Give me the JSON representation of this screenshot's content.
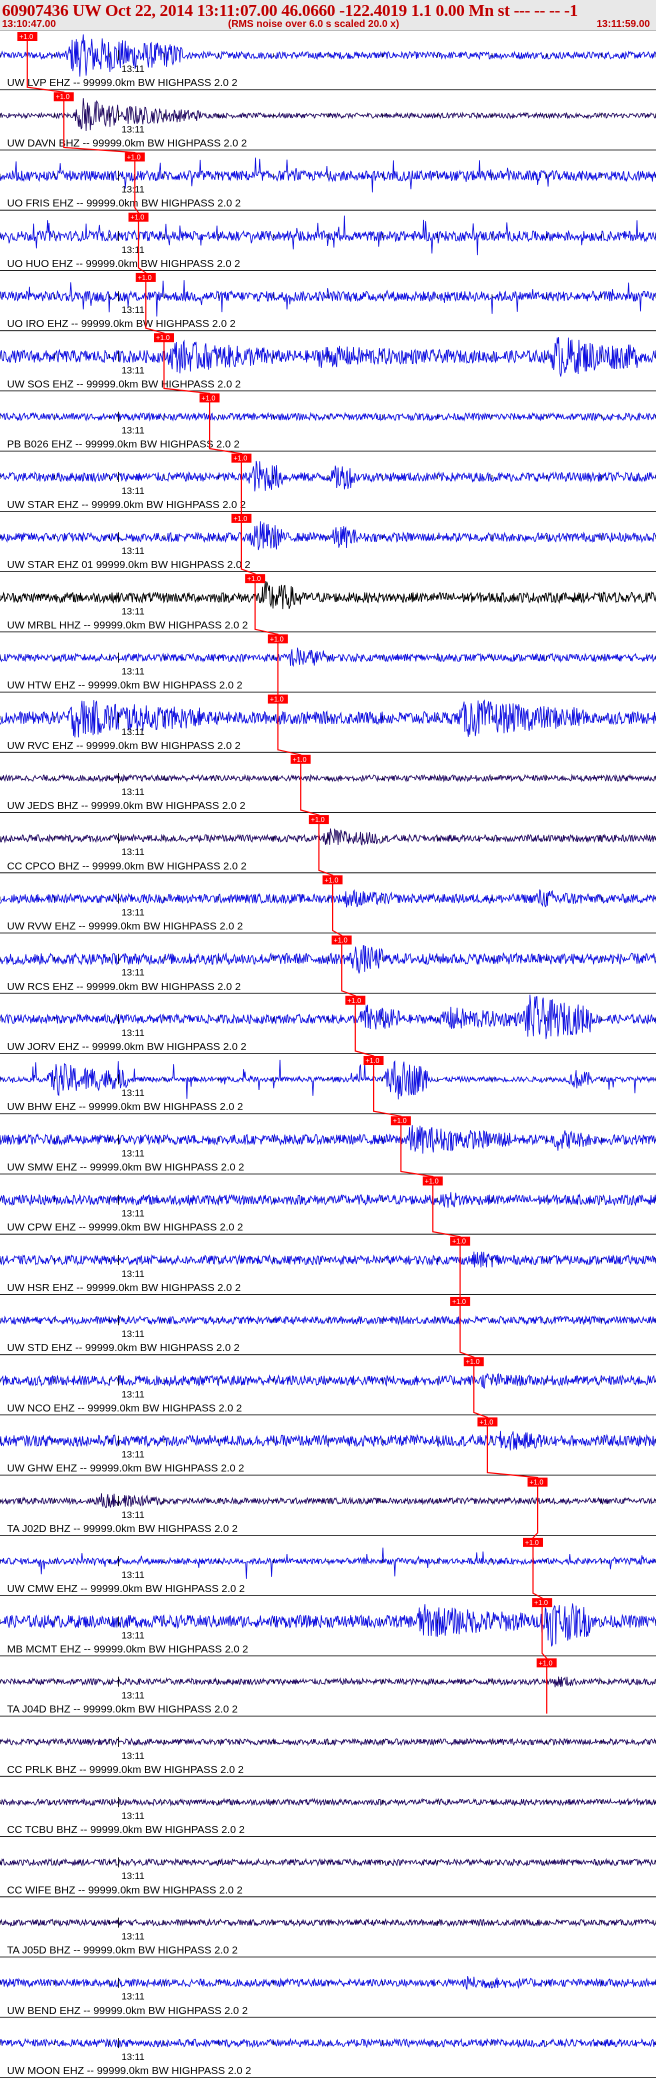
{
  "header": {
    "title": "60907436 UW Oct 22, 2014 13:11:07.00   46.0660 -122.4019  1.1 0.00 Mn st --- -- --   -1",
    "start_time": "13:10:47.00",
    "end_time": "13:11:59.00",
    "note": "(RMS noise over 6.0 s scaled 20.0 x)"
  },
  "colors": {
    "trace": "#1010e0",
    "trace_dark": "#200860",
    "trace_black": "#000000",
    "pick": "#ff0000",
    "header_text": "#c00000",
    "header_bg": "#e8e8e8"
  },
  "chart_data": {
    "type": "line",
    "time_window": [
      "13:10:47.00",
      "13:11:59.00"
    ],
    "tick_label": "13:11",
    "pick_label": "+1.0",
    "traces": [
      {
        "label": "UW LVP EHZ -- 99999.0km BW  HIGHPASS  2.0  2",
        "pick_time": 3.0,
        "color": "blue",
        "bursts": [
          [
            7,
            20,
            1.0
          ]
        ],
        "noise": 0.14
      },
      {
        "label": "UW DAVN BHZ -- 99999.0km BW  HIGHPASS  2.0  2",
        "pick_time": 7.0,
        "color": "dark",
        "bursts": [
          [
            8,
            13,
            1.0
          ],
          [
            13,
            22,
            0.5
          ]
        ],
        "noise": 0.1
      },
      {
        "label": "UO FRIS EHZ -- 99999.0km BW  HIGHPASS  2.0  2",
        "pick_time": 14.8,
        "color": "blue",
        "bursts": [],
        "spiky": true,
        "noise": 0.2
      },
      {
        "label": "UO HUO EHZ -- 99999.0km BW  HIGHPASS  2.0  2",
        "pick_time": 15.2,
        "color": "blue",
        "bursts": [],
        "spiky": true,
        "noise": 0.2
      },
      {
        "label": "UO IRO EHZ -- 99999.0km BW  HIGHPASS  2.0  2",
        "pick_time": 16.0,
        "color": "blue",
        "bursts": [],
        "spiky": true,
        "noise": 0.2
      },
      {
        "label": "UW SOS EHZ -- 99999.0km BW  HIGHPASS  2.0  2",
        "pick_time": 18.0,
        "color": "blue",
        "bursts": [
          [
            18,
            30,
            0.8
          ],
          [
            34,
            55,
            0.5
          ],
          [
            60,
            70,
            1.0
          ]
        ],
        "noise": 0.25
      },
      {
        "label": "PB B026 EHZ -- 99999.0km BW  HIGHPASS  2.0  2",
        "pick_time": 23.0,
        "color": "blue",
        "bursts": [],
        "noise": 0.14
      },
      {
        "label": "UW STAR EHZ -- 99999.0km BW  HIGHPASS  2.0  2",
        "pick_time": 26.5,
        "color": "blue",
        "bursts": [
          [
            27,
            31,
            1.0
          ],
          [
            36,
            39,
            0.9
          ]
        ],
        "noise": 0.18
      },
      {
        "label": "UW STAR EHZ 01 99999.0km BW  HIGHPASS  2.0  2",
        "pick_time": 26.5,
        "color": "blue",
        "bursts": [
          [
            27,
            31,
            1.0
          ],
          [
            36,
            39,
            0.8
          ]
        ],
        "noise": 0.18
      },
      {
        "label": "UW MRBL HHZ -- 99999.0km BW  HIGHPASS  2.0  2",
        "pick_time": 28.0,
        "color": "black",
        "bursts": [
          [
            28,
            33,
            0.9
          ]
        ],
        "noise": 0.2
      },
      {
        "label": "UW HTW EHZ -- 99999.0km BW  HIGHPASS  2.0  2",
        "pick_time": 30.5,
        "color": "blue",
        "bursts": [
          [
            31,
            36,
            0.6
          ]
        ],
        "noise": 0.15
      },
      {
        "label": "UW RVC EHZ -- 99999.0km BW  HIGHPASS  2.0  2",
        "pick_time": 30.5,
        "color": "blue",
        "bursts": [
          [
            7,
            22,
            0.9
          ],
          [
            50,
            64,
            0.9
          ]
        ],
        "noise": 0.25
      },
      {
        "label": "UW JEDS BHZ -- 99999.0km BW  HIGHPASS  2.0  2",
        "pick_time": 33.0,
        "color": "dark",
        "bursts": [],
        "noise": 0.12
      },
      {
        "label": "CC CPCO BHZ -- 99999.0km BW  HIGHPASS  2.0  2",
        "pick_time": 35.0,
        "color": "dark",
        "bursts": [
          [
            35,
            42,
            0.5
          ]
        ],
        "noise": 0.14
      },
      {
        "label": "UW RVW EHZ -- 99999.0km BW  HIGHPASS  2.0  2",
        "pick_time": 36.5,
        "color": "blue",
        "bursts": [
          [
            37,
            43,
            0.5
          ],
          [
            58,
            64,
            0.5
          ]
        ],
        "noise": 0.18
      },
      {
        "label": "UW RCS EHZ -- 99999.0km BW  HIGHPASS  2.0  2",
        "pick_time": 37.5,
        "color": "blue",
        "bursts": [
          [
            38,
            42,
            0.9
          ]
        ],
        "noise": 0.22
      },
      {
        "label": "UW JORV EHZ -- 99999.0km BW  HIGHPASS  2.0  2",
        "pick_time": 39.0,
        "color": "blue",
        "bursts": [
          [
            39,
            44,
            0.8
          ],
          [
            48,
            57,
            0.6
          ],
          [
            57,
            65,
            1.2
          ]
        ],
        "noise": 0.18
      },
      {
        "label": "UW BHW EHZ -- 99999.0km BW  HIGHPASS  2.0  2",
        "pick_time": 41.0,
        "color": "blue",
        "bursts": [
          [
            5,
            14,
            0.8
          ],
          [
            42,
            47,
            1.2
          ],
          [
            62,
            65,
            0.6
          ]
        ],
        "spiky": true,
        "noise": 0.1
      },
      {
        "label": "UW SMW EHZ -- 99999.0km BW  HIGHPASS  2.0  2",
        "pick_time": 44.0,
        "color": "blue",
        "bursts": [
          [
            44,
            56,
            0.7
          ],
          [
            60,
            65,
            0.6
          ]
        ],
        "noise": 0.2
      },
      {
        "label": "UW CPW EHZ -- 99999.0km BW  HIGHPASS  2.0  2",
        "pick_time": 47.5,
        "color": "blue",
        "bursts": [
          [
            48,
            52,
            0.5
          ]
        ],
        "noise": 0.2
      },
      {
        "label": "UW HSR EHZ -- 99999.0km BW  HIGHPASS  2.0  2",
        "pick_time": 50.5,
        "color": "blue",
        "bursts": [
          [
            51,
            56,
            0.5
          ]
        ],
        "noise": 0.18
      },
      {
        "label": "UW STD EHZ -- 99999.0km BW  HIGHPASS  2.0  2",
        "pick_time": 50.5,
        "color": "blue",
        "bursts": [],
        "noise": 0.15
      },
      {
        "label": "UW NCO EHZ -- 99999.0km BW  HIGHPASS  2.0  2",
        "pick_time": 52.0,
        "color": "blue",
        "bursts": [
          [
            52,
            60,
            0.4
          ]
        ],
        "noise": 0.2
      },
      {
        "label": "UW GHW EHZ -- 99999.0km BW  HIGHPASS  2.0  2",
        "pick_time": 53.5,
        "color": "blue",
        "bursts": [
          [
            54,
            60,
            0.6
          ]
        ],
        "noise": 0.22
      },
      {
        "label": "TA J02D BHZ -- 99999.0km BW  HIGHPASS  2.0  2",
        "pick_time": 59.0,
        "color": "dark",
        "bursts": [
          [
            10,
            18,
            0.4
          ]
        ],
        "noise": 0.12
      },
      {
        "label": "UW CMW EHZ -- 99999.0km BW  HIGHPASS  2.0  2",
        "pick_time": 58.5,
        "color": "blue",
        "bursts": [],
        "spiky": true,
        "noise": 0.12
      },
      {
        "label": "MB MCMT EHZ -- 99999.0km BW  HIGHPASS  2.0  2",
        "pick_time": 59.5,
        "color": "blue",
        "bursts": [
          [
            45,
            58,
            0.8
          ],
          [
            59,
            65,
            1.3
          ]
        ],
        "noise": 0.25
      },
      {
        "label": "TA J04D BHZ -- 99999.0km BW  HIGHPASS  2.0  2",
        "pick_time": 60.0,
        "color": "dark",
        "bursts": [
          [
            60,
            63,
            0.4
          ]
        ],
        "noise": 0.12
      },
      {
        "label": "CC PRLK BHZ -- 99999.0km BW  HIGHPASS  2.0  2",
        "pick_time": null,
        "color": "dark",
        "bursts": [],
        "noise": 0.12
      },
      {
        "label": "CC TCBU BHZ -- 99999.0km BW  HIGHPASS  2.0  2",
        "pick_time": null,
        "color": "dark",
        "bursts": [],
        "noise": 0.12
      },
      {
        "label": "CC WIFE BHZ -- 99999.0km BW  HIGHPASS  2.0  2",
        "pick_time": null,
        "color": "dark",
        "bursts": [],
        "noise": 0.12
      },
      {
        "label": "TA J05D BHZ -- 99999.0km BW  HIGHPASS  2.0  2",
        "pick_time": null,
        "color": "dark",
        "bursts": [],
        "noise": 0.12
      },
      {
        "label": "UW BEND EHZ -- 99999.0km BW  HIGHPASS  2.0  2",
        "pick_time": null,
        "color": "blue",
        "bursts": [
          [
            50,
            65,
            0.3
          ]
        ],
        "noise": 0.15
      },
      {
        "label": "UW MOON EHZ -- 99999.0km BW  HIGHPASS  2.0  2",
        "pick_time": null,
        "color": "blue",
        "bursts": [],
        "noise": 0.15
      }
    ]
  }
}
